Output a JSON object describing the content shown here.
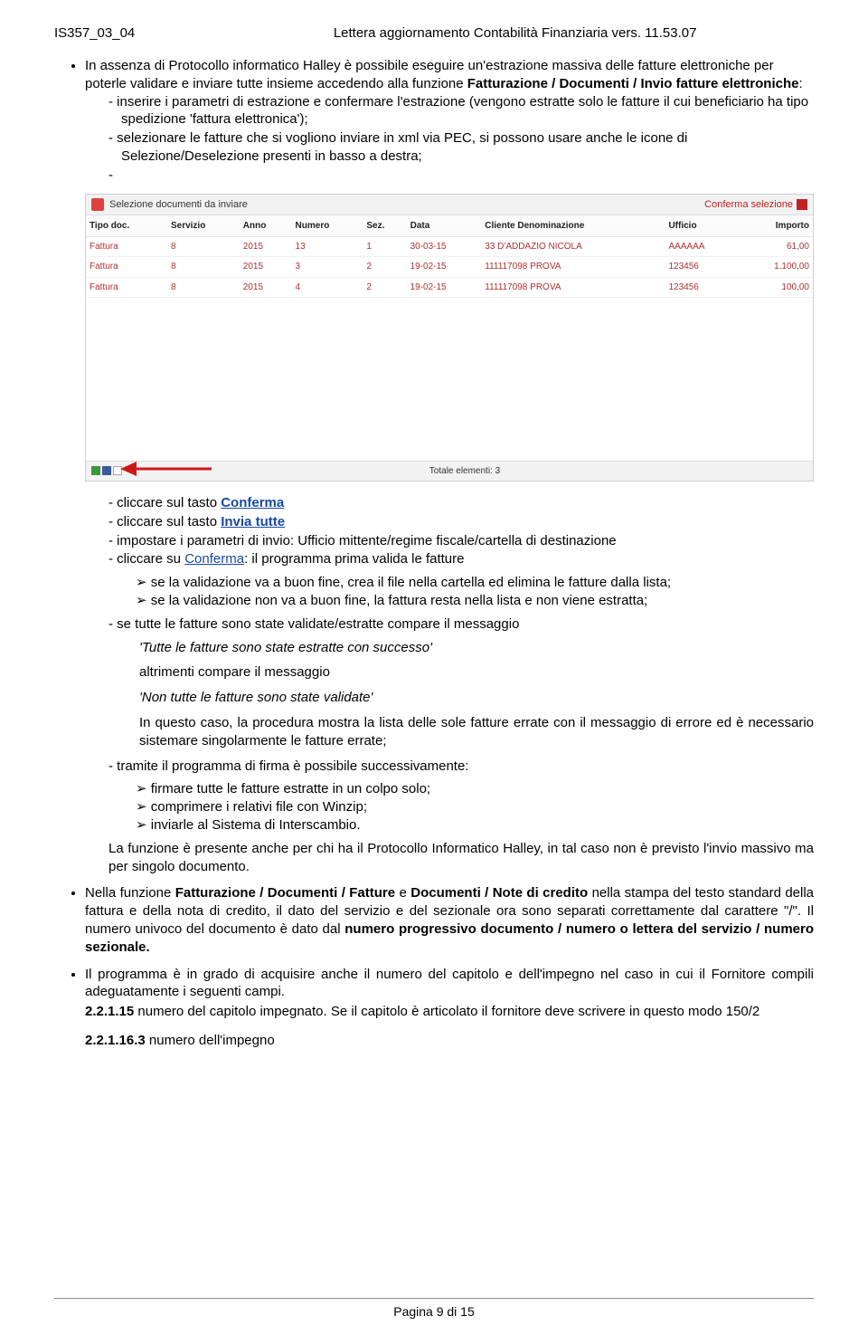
{
  "header": {
    "code": "IS357_03_04",
    "title": "Lettera aggiornamento Contabilità Finanziaria  vers. 11.53.07"
  },
  "intro": {
    "main": "In assenza di Protocollo informatico Halley è possibile eseguire un'estrazione massiva delle fatture elettroniche per poterle validare e inviare tutte insieme accedendo alla funzione ",
    "bold1": "Fatturazione / Documenti / Invio fatture elettroniche",
    "after": ":",
    "sub1": "inserire i parametri di estrazione e confermare l'estrazione (vengono estratte solo le fatture il cui beneficiario ha tipo spedizione 'fattura elettronica');",
    "sub2": "selezionare le fatture che si vogliono inviare in xml via PEC, si possono usare anche le icone di Selezione/Deselezione presenti in basso a destra;"
  },
  "screenshot": {
    "title": "Selezione documenti da inviare",
    "confirm": "Conferma selezione",
    "cols": [
      "Tipo doc.",
      "Servizio",
      "Anno",
      "Numero",
      "Sez.",
      "Data",
      "Cliente Denominazione",
      "Ufficio",
      "Importo"
    ],
    "rows": [
      [
        "Fattura",
        "8",
        "2015",
        "13",
        "1",
        "30-03-15",
        "33 D'ADDAZIO NICOLA",
        "AAAAAA",
        "61,00"
      ],
      [
        "Fattura",
        "8",
        "2015",
        "3",
        "2",
        "19-02-15",
        "111117098 PROVA",
        "123456",
        "1.100,00"
      ],
      [
        "Fattura",
        "8",
        "2015",
        "4",
        "2",
        "19-02-15",
        "111117098 PROVA",
        "123456",
        "100,00"
      ]
    ],
    "total": "Totale elementi: 3"
  },
  "steps": {
    "s1a": "cliccare sul tasto ",
    "s1b": "Conferma",
    "s2a": "cliccare sul tasto ",
    "s2b": "Invia tutte",
    "s3": "impostare i parametri di invio: Ufficio mittente/regime fiscale/cartella di destinazione",
    "s4a": "cliccare su ",
    "s4b": "Conferma",
    "s4c": ": il programma prima valida le fatture",
    "a1": "se la validazione va a buon fine, crea il file nella cartella ed elimina le fatture dalla lista;",
    "a2": "se la validazione non va a buon fine, la fattura resta nella lista e non viene estratta;",
    "s5": "se tutte le fatture sono state validate/estratte compare il messaggio",
    "msg1": "'Tutte le fatture sono state estratte con successo'",
    "alt": "altrimenti compare il messaggio",
    "msg2": "'Non tutte le fatture sono state validate'",
    "expl": "In questo caso, la procedura mostra la lista delle sole fatture errate con il messaggio di errore ed è necessario sistemare singolarmente le fatture errate;",
    "s6": "tramite il programma di firma è possibile successivamente:",
    "a3": "firmare tutte le fatture estratte in un colpo solo;",
    "a4": "comprimere i relativi file con Winzip;",
    "a5": "inviarle al Sistema di Interscambio.",
    "tail": "La funzione è presente anche per chi ha il Protocollo Informatico Halley, in tal caso non è previsto l'invio massivo ma per singolo documento."
  },
  "bullet2": {
    "p1": "Nella funzione ",
    "b1": "Fatturazione / Documenti / Fatture",
    "p2": " e ",
    "b2": "Documenti / Note di credito",
    "p3": " nella stampa del testo standard della fattura e della nota di credito, il dato del servizio e del sezionale ora sono separati correttamente dal carattere \"/\". Il numero univoco del documento è dato dal ",
    "b3": "numero progressivo documento / numero o lettera del servizio / numero sezionale.",
    "b3_label": "numero progressivo documento / numero o lettera del servizio / numero sezionale."
  },
  "bullet3": {
    "p1": "Il programma è in grado di acquisire anche il numero del capitolo e dell'impegno nel caso in cui il Fornitore compili adeguatamente i seguenti campi.",
    "n1a": "2.2.1.15",
    "n1b": " numero del capitolo impegnato. Se il capitolo è articolato il fornitore deve scrivere in questo modo 150/2",
    "n2a": "2.2.1.16.3",
    "n2b": " numero dell'impegno"
  },
  "footer": "Pagina 9 di 15"
}
